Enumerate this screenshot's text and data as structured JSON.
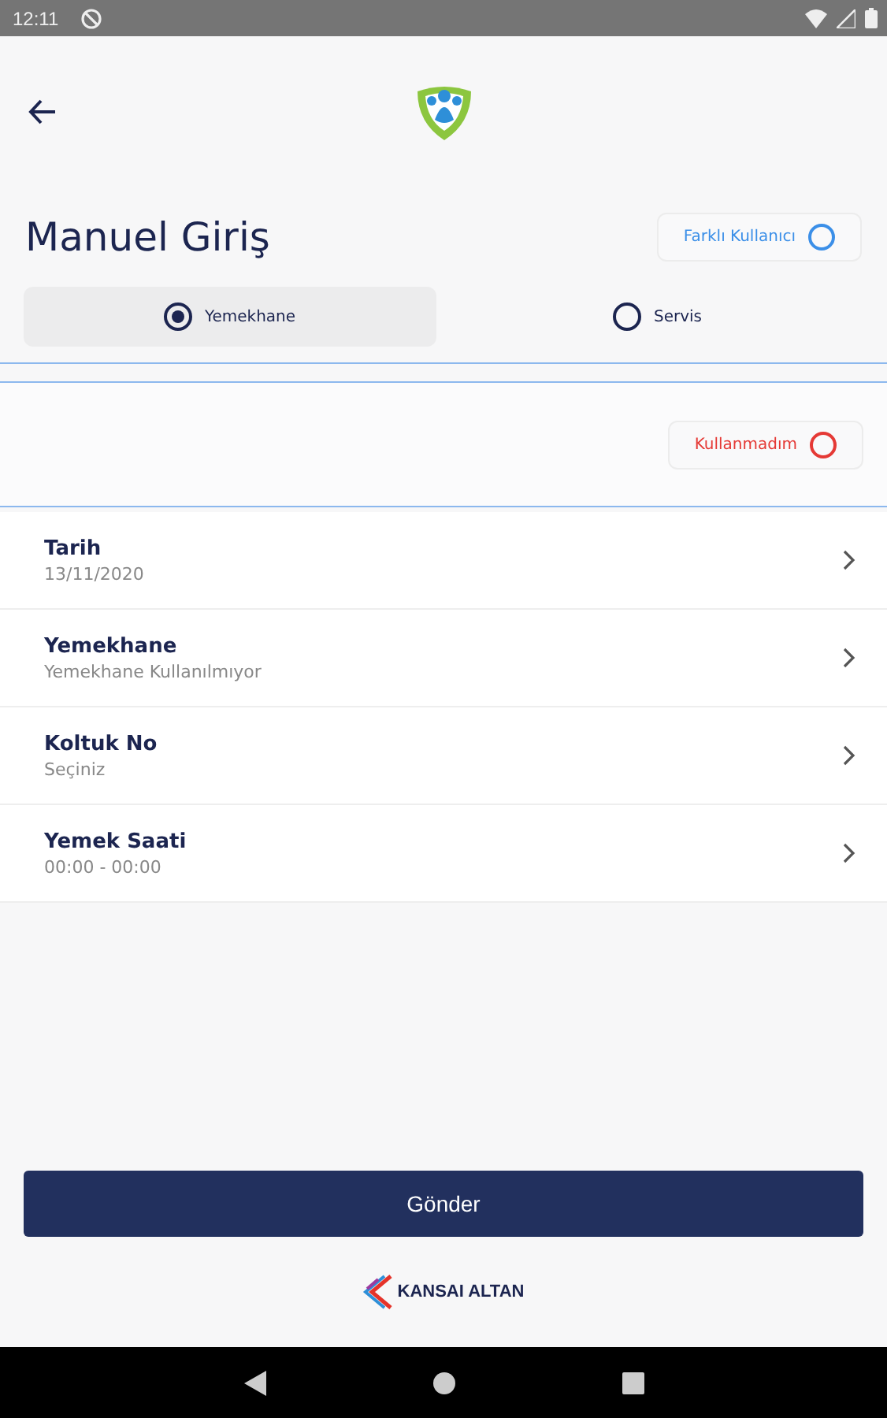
{
  "status_bar": {
    "time": "12:11"
  },
  "title": "Manuel Giriş",
  "other_user": {
    "label": "Farklı Kullanıcı",
    "on": false
  },
  "options": [
    {
      "label": "Yemekhane",
      "selected": true
    },
    {
      "label": "Servis",
      "selected": false
    }
  ],
  "not_used": {
    "label": "Kullanmadım",
    "on": false
  },
  "fields": [
    {
      "label": "Tarih",
      "value": "13/11/2020"
    },
    {
      "label": "Yemekhane",
      "value": "Yemekhane Kullanılmıyor"
    },
    {
      "label": "Koltuk No",
      "value": "Seçiniz"
    },
    {
      "label": "Yemek Saati",
      "value": "00:00 - 00:00"
    }
  ],
  "submit": "Gönder",
  "footer_brand": "KANSAI ALTAN"
}
